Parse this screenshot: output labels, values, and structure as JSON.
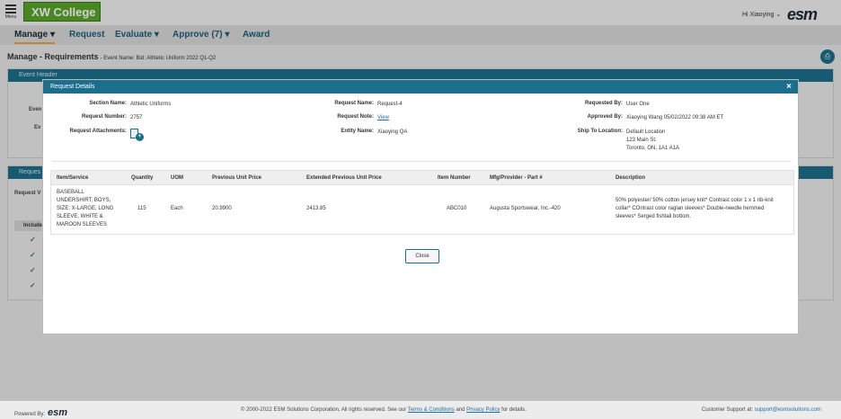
{
  "header": {
    "menu_label": "Menu",
    "college_logo": "XW College",
    "greeting": "Hi Xiaoying",
    "esm_logo": "esm"
  },
  "nav": {
    "items": [
      {
        "label": "Manage"
      },
      {
        "label": "Request"
      },
      {
        "label": "Evaluate"
      },
      {
        "label": "Approve (7)"
      },
      {
        "label": "Award"
      }
    ]
  },
  "page": {
    "title": "Manage - Requirements",
    "subtitle": "- Event Name: Bid: Athletic Uniform 2022 Q1-Q2"
  },
  "background": {
    "event_header": "Event Header",
    "requests_panel": "Reques",
    "event_lbl_1": "Even",
    "event_lbl_2": "Ev",
    "request_v": "Request V",
    "include": "Include"
  },
  "modal": {
    "title": "Request Details",
    "close_x": "×",
    "fields": {
      "section_name_label": "Section Name:",
      "section_name": "Athletic Uniforms",
      "request_number_label": "Request Number:",
      "request_number": "2757",
      "request_attachments_label": "Request Attachments:",
      "request_name_label": "Request Name:",
      "request_name": "Request-4",
      "request_note_label": "Request Note:",
      "request_note": "View",
      "entity_name_label": "Entity Name:",
      "entity_name": "Xiaoying QA",
      "requested_by_label": "Requested By:",
      "requested_by": "User One",
      "approved_by_label": "Approved By:",
      "approved_by": "Xiaoying Wang 05/02/2022 09:38 AM ET",
      "ship_to_label": "Ship To Location:",
      "ship_to_1": "Default Location",
      "ship_to_2": "123 Main St.",
      "ship_to_3": "Toronto, ON, 1A1 A1A"
    },
    "table": {
      "headers": {
        "item": "Item/Service",
        "quantity": "Quantity",
        "uom": "UOM",
        "prev_price": "Previous Unit Price",
        "ext_prev_price": "Extended Previous Unit Price",
        "item_number": "Item Number",
        "mfg": "Mfg/Provider - Part #",
        "description": "Description"
      },
      "row": {
        "item_1": "BASEBALL",
        "item_2": "UNDERSHIRT, BOYS,",
        "item_3": "SIZE: X-LARGE, LONG",
        "item_4": "SLEEVE, WHITE &",
        "item_5": "MAROON SLEEVES",
        "quantity": "115",
        "uom": "Each",
        "prev_price": "20.9900",
        "ext_prev_price": "2413.85",
        "item_number": "ABC010",
        "mfg": "Augusta Sportswear, Inc.-420",
        "desc_1": "50% polyester/ 50% cotton jersey knit* Contrast color 1 x 1 rib-knit",
        "desc_2": "collar* COntrast color raglan sleeves* Double-needle hemmed",
        "desc_3": "sleeves* Serged fishtail bottom."
      }
    },
    "close_button": "Close"
  },
  "footer": {
    "powered_by": "Powered By:",
    "powered_logo": "esm",
    "copyright": "© 2000-2022 ESM Solutions Corporation, All rights reserved. See our",
    "terms": "Terms & Conditions",
    "and": "and",
    "privacy": "Privacy Policy",
    "for_details": "for details.",
    "support_label": "Customer Support at:",
    "support_email": "support@esmsolutions.com"
  },
  "colors": {
    "accent_teal": "#1b6f8c",
    "brand_green": "#5aa52a",
    "nav_active_underline": "#e8a33d"
  }
}
